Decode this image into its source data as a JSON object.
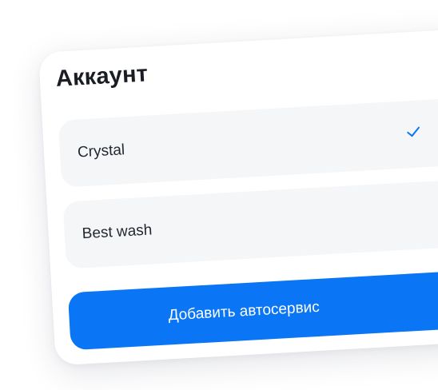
{
  "card": {
    "title": "Аккаунт"
  },
  "accounts": [
    {
      "label": "Crystal",
      "selected": true
    },
    {
      "label": "Best wash",
      "selected": false
    }
  ],
  "icons": {
    "selected_indicator": "checkmark-icon"
  },
  "actions": {
    "add_service_label": "Добавить автосервис"
  },
  "colors": {
    "accent": "#0a76f6",
    "item_background": "#f5f6f8",
    "title_text": "#1a1d24"
  }
}
